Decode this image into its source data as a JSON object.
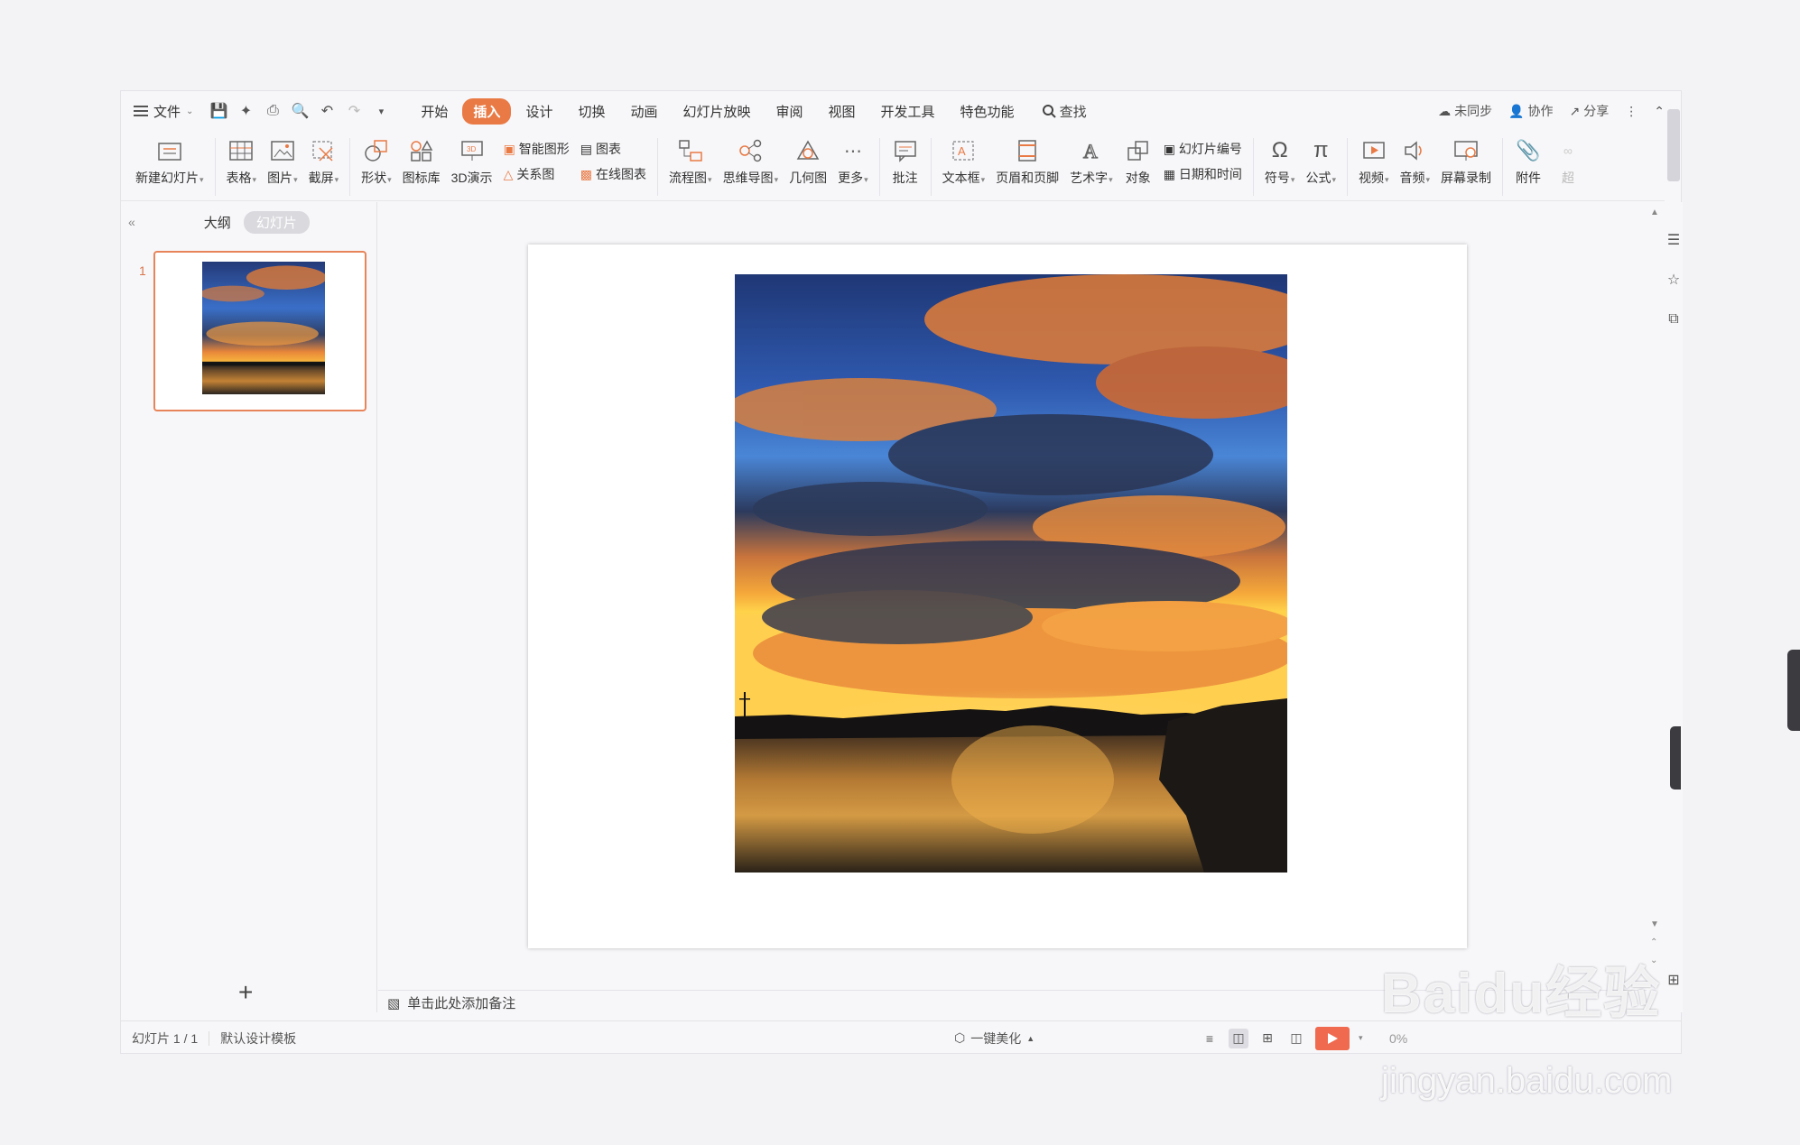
{
  "menu": {
    "file_label": "文件"
  },
  "tabs": [
    {
      "label": "开始",
      "active": false
    },
    {
      "label": "插入",
      "active": true
    },
    {
      "label": "设计",
      "active": false
    },
    {
      "label": "切换",
      "active": false
    },
    {
      "label": "动画",
      "active": false
    },
    {
      "label": "幻灯片放映",
      "active": false
    },
    {
      "label": "审阅",
      "active": false
    },
    {
      "label": "视图",
      "active": false
    },
    {
      "label": "开发工具",
      "active": false
    },
    {
      "label": "特色功能",
      "active": false
    }
  ],
  "search_label": "查找",
  "topright": {
    "sync": "未同步",
    "collab": "协作",
    "share": "分享"
  },
  "ribbon": {
    "new_slide": "新建幻灯片",
    "table": "表格",
    "picture": "图片",
    "screenshot": "截屏",
    "shape": "形状",
    "icon_lib": "图标库",
    "demo3d": "3D演示",
    "smart_art": "智能图形",
    "chart": "图表",
    "relation": "关系图",
    "online_chart": "在线图表",
    "flowchart": "流程图",
    "mindmap": "思维导图",
    "geometry": "几何图",
    "more": "更多",
    "comment": "批注",
    "textbox": "文本框",
    "header_footer": "页眉和页脚",
    "wordart": "艺术字",
    "object": "对象",
    "slide_number": "幻灯片编号",
    "datetime": "日期和时间",
    "symbol": "符号",
    "formula": "公式",
    "video": "视频",
    "audio": "音频",
    "screen_record": "屏幕录制",
    "attachment": "附件",
    "hyperlink": "超"
  },
  "left_panel": {
    "outline_tab": "大纲",
    "slides_tab": "幻灯片",
    "slide_number": "1"
  },
  "notes_placeholder": "单击此处添加备注",
  "status": {
    "slide_count": "幻灯片 1 / 1",
    "template": "默认设计模板",
    "beautify": "一键美化",
    "zoom": "0%"
  },
  "colors": {
    "accent": "#e97a45",
    "play": "#ef6a4f"
  },
  "watermark": {
    "logo": "Baidu经验",
    "url": "jingyan.baidu.com"
  }
}
